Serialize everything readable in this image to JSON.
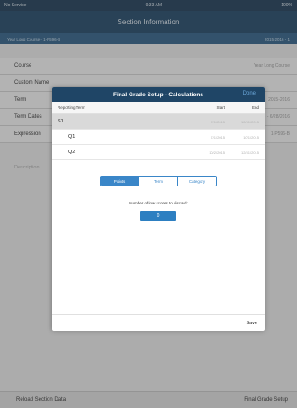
{
  "status_bar": {
    "carrier": "No Service",
    "time": "9:33 AM",
    "battery": "100%"
  },
  "nav": {
    "title": "Section Information"
  },
  "subheader": {
    "course_section": "Year Long Course - 1-P596-B",
    "year": "2015-2016 - 1"
  },
  "background_rows": [
    {
      "label": "Course",
      "value": "Year Long Course"
    },
    {
      "label": "Custom Name",
      "value": ""
    },
    {
      "label": "Term",
      "value": "2015-2016"
    },
    {
      "label": "Term Dates",
      "value": "7/1/2015 - 6/28/2016"
    },
    {
      "label": "Expression",
      "value": "1-P596-B"
    }
  ],
  "background_description": "Description",
  "footer": {
    "reload": "Reload Section Data",
    "final_grade": "Final Grade Setup"
  },
  "modal": {
    "title": "Final Grade Setup - Calculations",
    "done": "Done",
    "columns": {
      "term": "Reporting Term",
      "start": "Start",
      "end": "End"
    },
    "rows": [
      {
        "term": "S1",
        "start": "7/1/2015",
        "end": "12/31/2015"
      },
      {
        "term": "Q1",
        "start": "7/1/2015",
        "end": "10/1/2015"
      },
      {
        "term": "Q2",
        "start": "10/2/2015",
        "end": "12/31/2015"
      }
    ],
    "segments": [
      "Points",
      "Term",
      "Category"
    ],
    "active_segment": "Points",
    "discard_label": "Number of low scores to discard:",
    "discard_value": "0",
    "save": "Save"
  },
  "colors": {
    "nav_bg": "#1f4566",
    "accent": "#3a86c8",
    "selected_row": "#d9d9d9"
  }
}
